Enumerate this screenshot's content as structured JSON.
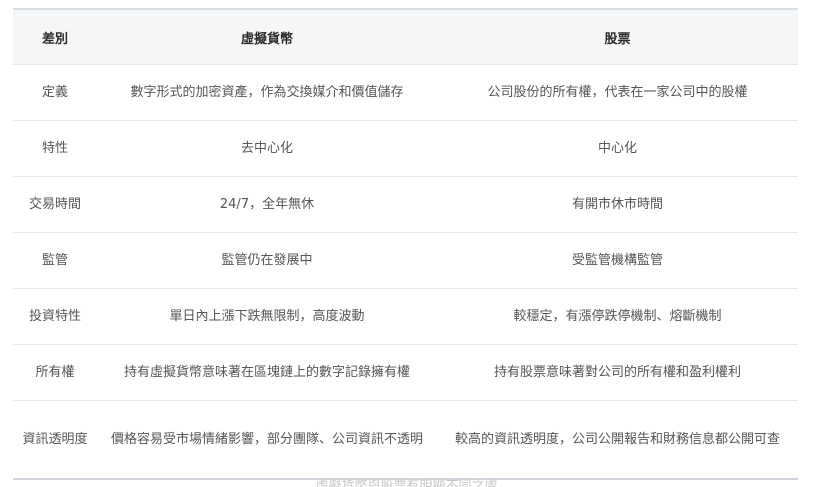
{
  "table": {
    "headers": [
      "差別",
      "虛擬貨幣",
      "股票"
    ],
    "rows": [
      [
        "定義",
        "數字形式的加密資產，作為交換媒介和價值儲存",
        "公司股份的所有權，代表在一家公司中的股權"
      ],
      [
        "特性",
        "去中心化",
        "中心化"
      ],
      [
        "交易時間",
        "24/7，全年無休",
        "有開市休市時間"
      ],
      [
        "監管",
        "監管仍在發展中",
        "受監管機構監管"
      ],
      [
        "投資特性",
        "單日內上漲下跌無限制，高度波動",
        "較穩定，有漲停跌停機制、熔斷機制"
      ],
      [
        "所有權",
        "持有虛擬貨幣意味著在區塊鏈上的數字記錄擁有權",
        "持有股票意味著對公司的所有權和盈利權利"
      ],
      [
        "資訊透明度",
        "價格容易受市場情緒影響，部分團隊、公司資訊不透明",
        "較高的資訊透明度，公司公開報告和財務信息都公開可查"
      ]
    ]
  },
  "footer": {
    "text": "虛擬貨幣與股票有明顯不同之處"
  }
}
